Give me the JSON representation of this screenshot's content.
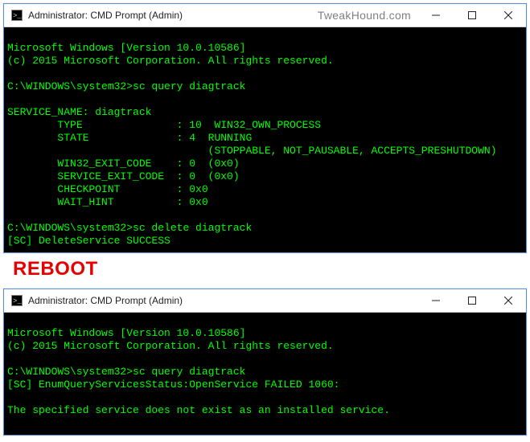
{
  "watermark": "TweakHound.com",
  "reboot_label": "REBOOT",
  "window1": {
    "title": "Administrator: CMD Prompt (Admin)",
    "lines": {
      "l1": "Microsoft Windows [Version 10.0.10586]",
      "l2": "(c) 2015 Microsoft Corporation. All rights reserved.",
      "blank1": "",
      "prompt1": "C:\\WINDOWS\\system32>",
      "cmd1": "sc query diagtrack",
      "blank2": "",
      "svc_name": "SERVICE_NAME: diagtrack",
      "type": "        TYPE               : 10  WIN32_OWN_PROCESS",
      "state": "        STATE              : 4  RUNNING",
      "state2": "                                (STOPPABLE, NOT_PAUSABLE, ACCEPTS_PRESHUTDOWN)",
      "wexit": "        WIN32_EXIT_CODE    : 0  (0x0)",
      "sexit": "        SERVICE_EXIT_CODE  : 0  (0x0)",
      "chk": "        CHECKPOINT         : 0x0",
      "wait": "        WAIT_HINT          : 0x0",
      "blank3": "",
      "prompt2": "C:\\WINDOWS\\system32>",
      "cmd2": "sc delete diagtrack",
      "result": "[SC] DeleteService SUCCESS"
    }
  },
  "window2": {
    "title": "Administrator: CMD Prompt (Admin)",
    "lines": {
      "l1": "Microsoft Windows [Version 10.0.10586]",
      "l2": "(c) 2015 Microsoft Corporation. All rights reserved.",
      "blank1": "",
      "prompt1": "C:\\WINDOWS\\system32>",
      "cmd1": "sc query diagtrack",
      "err1": "[SC] EnumQueryServicesStatus:OpenService FAILED 1060:",
      "blank2": "",
      "err2": "The specified service does not exist as an installed service.",
      "blank3": ""
    }
  }
}
